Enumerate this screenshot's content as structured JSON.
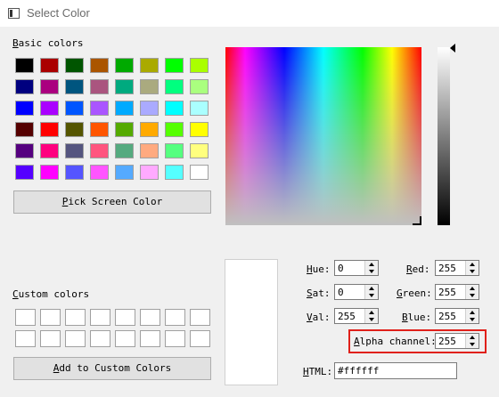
{
  "window": {
    "title": "Select Color"
  },
  "basic_colors": {
    "label": "Basic colors",
    "swatches": [
      "#000000",
      "#aa0000",
      "#005500",
      "#aa5500",
      "#00aa00",
      "#aaaa00",
      "#00ff00",
      "#aaff00",
      "#00007f",
      "#aa007f",
      "#00557f",
      "#aa557f",
      "#00aa7f",
      "#aaaa7f",
      "#00ff7f",
      "#aaff7f",
      "#0000ff",
      "#aa00ff",
      "#0055ff",
      "#aa55ff",
      "#00aaff",
      "#aaaaff",
      "#00ffff",
      "#aaffff",
      "#550000",
      "#ff0000",
      "#555500",
      "#ff5500",
      "#55aa00",
      "#ffaa00",
      "#55ff00",
      "#ffff00",
      "#55007f",
      "#ff007f",
      "#55557f",
      "#ff557f",
      "#55aa7f",
      "#ffaa7f",
      "#55ff7f",
      "#ffff7f",
      "#5500ff",
      "#ff00ff",
      "#5555ff",
      "#ff55ff",
      "#55aaff",
      "#ffaaff",
      "#55ffff",
      "#ffffff"
    ]
  },
  "pick_screen_button": "Pick Screen Color",
  "custom_colors": {
    "label": "Custom colors",
    "count": 16
  },
  "add_custom_button": "Add to Custom Colors",
  "fields": {
    "hue": {
      "label": "Hue:",
      "value": "0"
    },
    "sat": {
      "label": "Sat:",
      "value": "0"
    },
    "val": {
      "label": "Val:",
      "value": "255"
    },
    "red": {
      "label": "Red:",
      "value": "255"
    },
    "green": {
      "label": "Green:",
      "value": "255"
    },
    "blue": {
      "label": "Blue:",
      "value": "255"
    },
    "alpha": {
      "label": "Alpha channel:",
      "value": "255"
    },
    "html": {
      "label": "HTML:",
      "value": "#ffffff"
    }
  },
  "colors": {
    "preview": "#ffffff",
    "highlight": "#e0201a"
  }
}
